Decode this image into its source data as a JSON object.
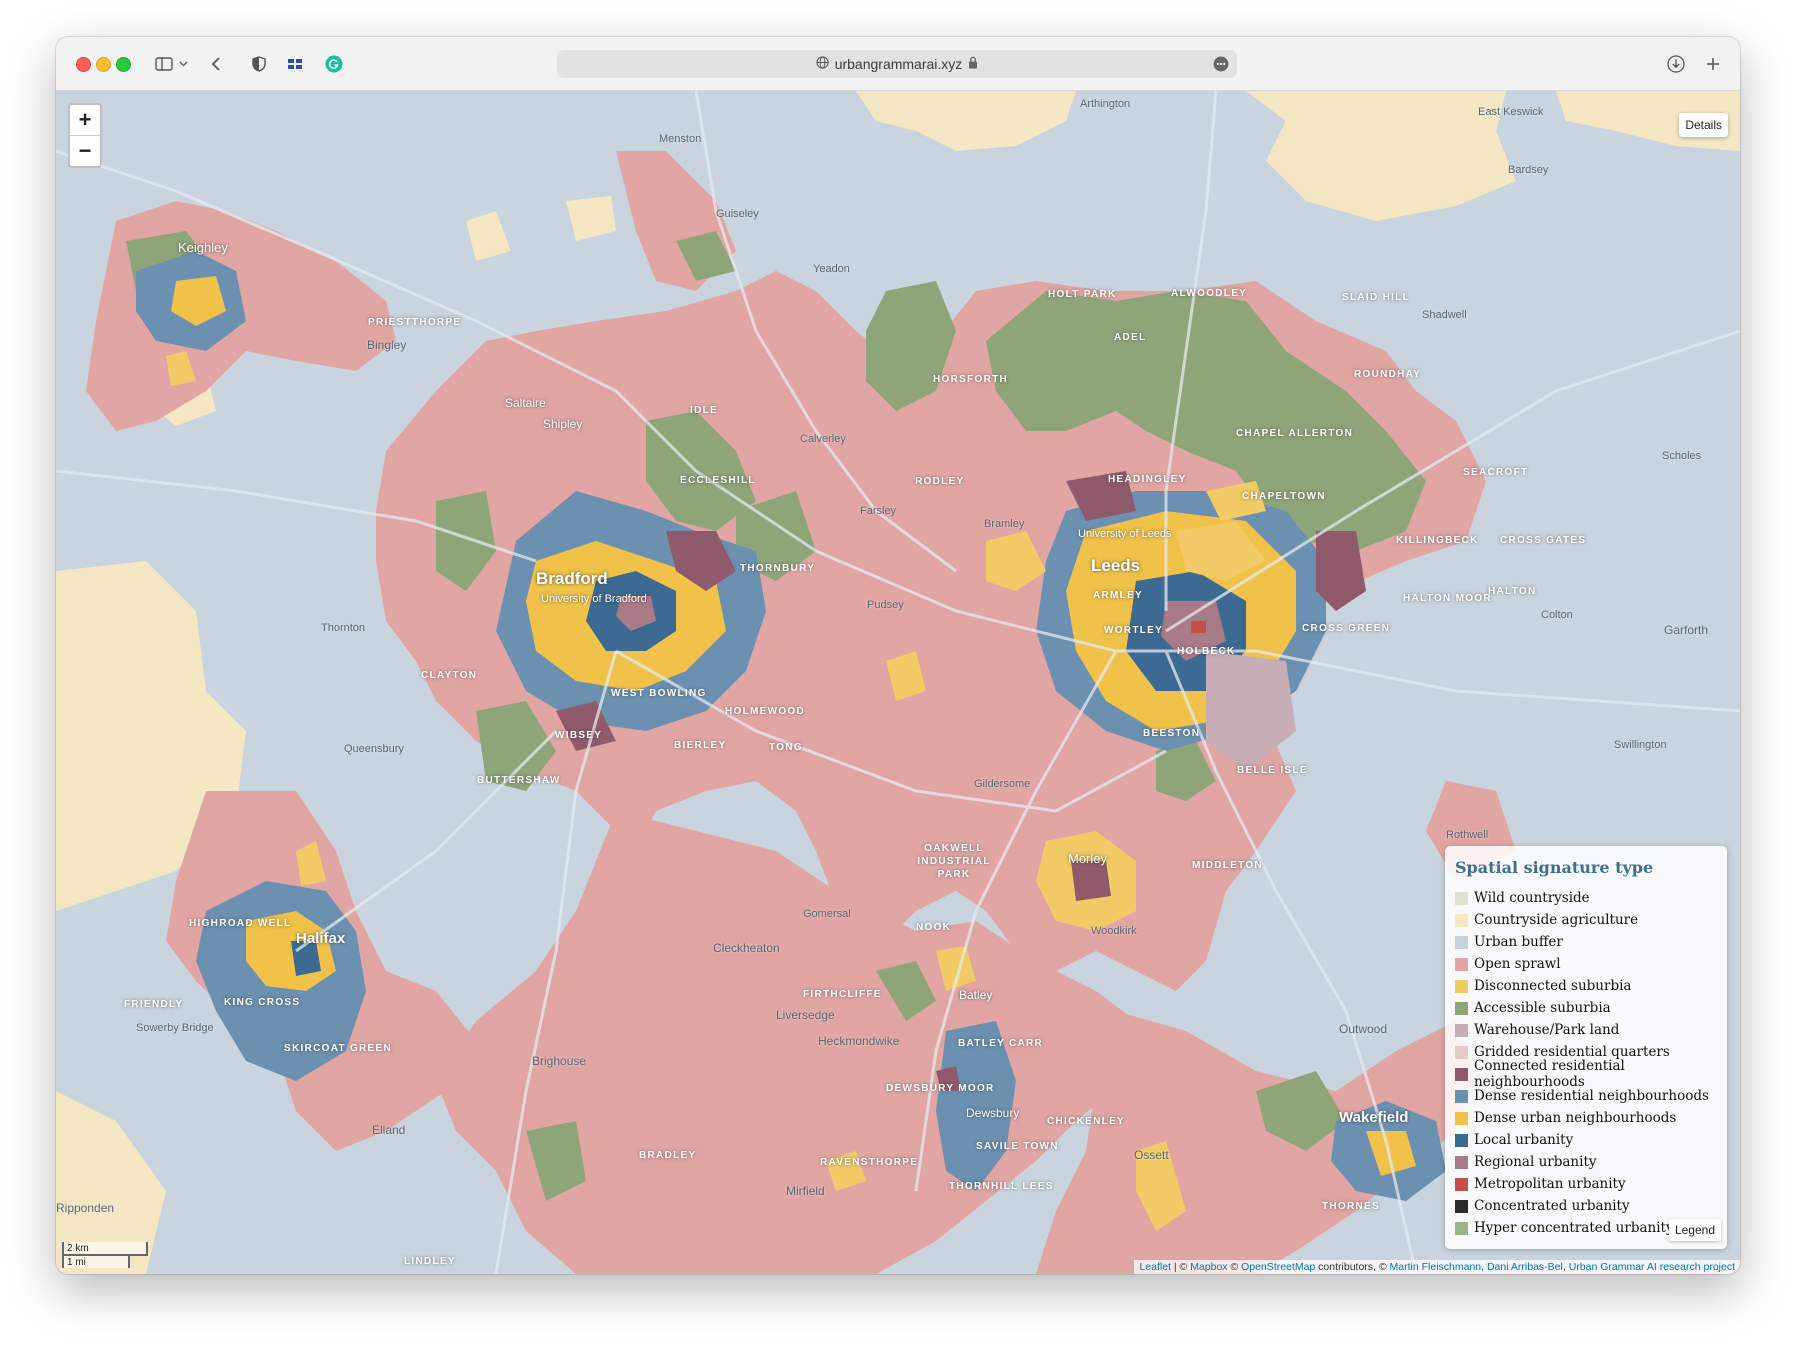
{
  "browser": {
    "url": "urbangrammarai.xyz"
  },
  "map": {
    "zoom_in": "+",
    "zoom_out": "−",
    "details_label": "Details",
    "scale_km": "2 km",
    "scale_mi": "1 mi",
    "attribution": {
      "leaflet": "Leaflet",
      "sep1": " | © ",
      "mapbox": "Mapbox",
      "sep2": " © ",
      "osm": "OpenStreetMap",
      "sep3": " contributors, © ",
      "authors": "Martin Fleischmann, Dani Arribas-Bel",
      "sep4": ", ",
      "project": "Urban Grammar AI research project"
    },
    "labels": {
      "leeds": "Leeds",
      "bradford": "Bradford",
      "halifax": "Halifax",
      "wakefield": "Wakefield",
      "morley": "Morley",
      "keighley": "Keighley",
      "univ_leeds": "University of Leeds",
      "univ_bradford": "University of Bradford",
      "menston": "Menston",
      "guiseley": "Guiseley",
      "yeadon": "Yeadon",
      "arthington": "Arthington",
      "east_keswick": "East Keswick",
      "bardsey": "Bardsey",
      "holt_park": "HOLT PARK",
      "alwoodley": "ALWOODLEY",
      "slaid_hill": "SLAID HILL",
      "shadwell": "Shadwell",
      "adel": "ADEL",
      "roundhay": "ROUNDHAY",
      "horsforth": "HORSFORTH",
      "chapel_allerton": "CHAPEL ALLERTON",
      "seacroft": "SEACROFT",
      "scholes": "Scholes",
      "chapeltown": "CHAPELTOWN",
      "headingley": "HEADINGLEY",
      "killingbeck": "KILLINGBECK",
      "cross_gates": "CROSS GATES",
      "halton": "HALTON",
      "halton_moor": "HALTON MOOR",
      "colton": "Colton",
      "garforth": "Garforth",
      "armley": "ARMLEY",
      "wortley": "WORTLEY",
      "holbeck": "HOLBECK",
      "cross_green": "CROSS GREEN",
      "beeston": "BEESTON",
      "belle_isle": "BELLE ISLE",
      "middleton": "MIDDLETON",
      "rothwell": "Rothwell",
      "swillington": "Swillington",
      "rodley": "RODLEY",
      "farsley": "Farsley",
      "bramley": "Bramley",
      "pudsey": "Pudsey",
      "calverley": "Calverley",
      "idle": "IDLE",
      "eccleshill": "ECCLESHILL",
      "thornbury": "THORNBURY",
      "saltaire": "Saltaire",
      "shipley": "Shipley",
      "priesthorpe": "PRIESTTHORPE",
      "bingley": "Bingley",
      "clayton": "CLAYTON",
      "wibsey": "WIBSEY",
      "west_bowling": "WEST BOWLING",
      "holmewood": "HOLMEWOOD",
      "bierley": "BIERLEY",
      "tong": "TONG",
      "buttershaw": "BUTTERSHAW",
      "thornton": "Thornton",
      "queensbury": "Queensbury",
      "gildersome": "Gildersome",
      "oakwell": "OAKWELL INDUSTRIAL PARK",
      "gomersal": "Gomersal",
      "cleckheaton": "Cleckheaton",
      "firthcliffe": "FIRTHCLIFFE",
      "liversedge": "Liversedge",
      "heckmondwike": "Heckmondwike",
      "batley": "Batley",
      "batley_carr": "BATLEY CARR",
      "dewsbury_moor": "DEWSBURY MOOR",
      "dewsbury": "Dewsbury",
      "chickenley": "CHICKENLEY",
      "savile_town": "SAVILE TOWN",
      "thornhill_lees": "THORNHILL LEES",
      "ravensthorpe": "RAVENSTHORPE",
      "mirfield": "Mirfield",
      "bradley": "BRADLEY",
      "brighouse": "Brighouse",
      "elland": "Elland",
      "highroad_well": "HIGHROAD WELL",
      "king_cross": "KING CROSS",
      "friendly": "FRIENDLY",
      "sowerby_bridge": "Sowerby Bridge",
      "skircoat_green": "SKIRCOAT GREEN",
      "ossett": "Ossett",
      "outwood": "Outwood",
      "thornes": "THORNES",
      "nook": "NOOK",
      "woodkirk": "Woodkirk",
      "ripponden": "Ripponden",
      "lindley": "LINDLEY"
    }
  },
  "legend": {
    "title": "Spatial signature type",
    "button": "Legend",
    "items": [
      {
        "label": "Wild countryside",
        "color": "#d9e3d0"
      },
      {
        "label": "Countryside agriculture",
        "color": "#f5e6c4"
      },
      {
        "label": "Urban buffer",
        "color": "#c6d3dd"
      },
      {
        "label": "Open sprawl",
        "color": "#e1a6a3"
      },
      {
        "label": "Disconnected suburbia",
        "color": "#f2cb66"
      },
      {
        "label": "Accessible suburbia",
        "color": "#8ea57a"
      },
      {
        "label": "Warehouse/Park land",
        "color": "#c7adb6"
      },
      {
        "label": "Gridded residential quarters",
        "color": "#e8c9cb"
      },
      {
        "label": "Connected residential neighbourhoods",
        "color": "#8f5a6b"
      },
      {
        "label": "Dense residential neighbourhoods",
        "color": "#6b90b0"
      },
      {
        "label": "Dense urban neighbourhoods",
        "color": "#f0c24a"
      },
      {
        "label": "Local urbanity",
        "color": "#3d6a92"
      },
      {
        "label": "Regional urbanity",
        "color": "#a97b86"
      },
      {
        "label": "Metropolitan urbanity",
        "color": "#c34f48"
      },
      {
        "label": "Concentrated urbanity",
        "color": "#2c2c2c"
      },
      {
        "label": "Hyper concentrated urbanity",
        "color": "#9cb38b"
      }
    ]
  }
}
